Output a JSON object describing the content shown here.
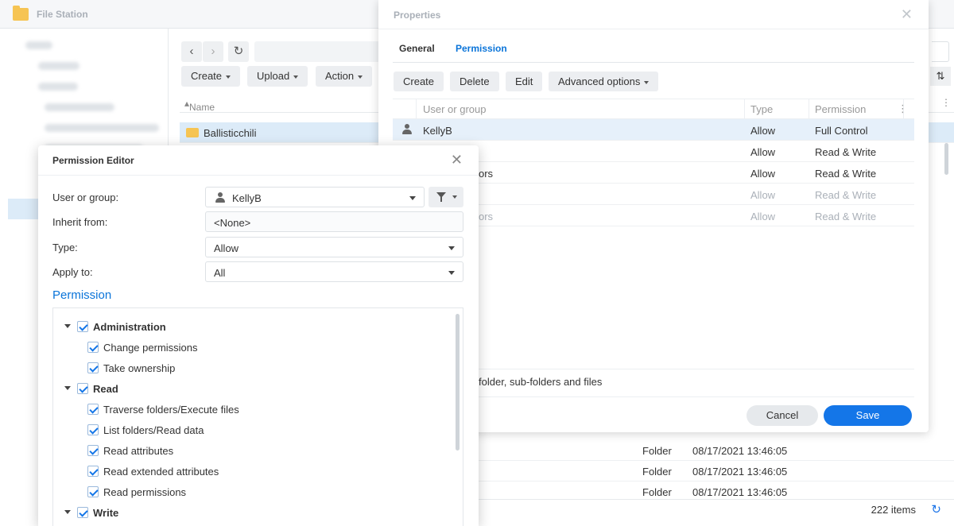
{
  "file_station": {
    "title": "File Station",
    "toolbar": {
      "create_label": "Create",
      "upload_label": "Upload",
      "action_label": "Action"
    },
    "column_name": "Name",
    "rows": [
      {
        "name": "Ballisticchili",
        "type": "",
        "date": ""
      },
      {
        "name": "",
        "type": "Folder",
        "date": "08/17/2021 13:46:05"
      },
      {
        "name": "",
        "type": "Folder",
        "date": "08/17/2021 13:46:05"
      },
      {
        "name": "",
        "type": "Folder",
        "date": "08/17/2021 13:46:05"
      }
    ],
    "item_count": "222 items"
  },
  "properties": {
    "title": "Properties",
    "tabs": [
      {
        "label": "General",
        "active": false
      },
      {
        "label": "Permission",
        "active": true
      }
    ],
    "buttons": {
      "create": "Create",
      "delete": "Delete",
      "edit": "Edit",
      "advanced": "Advanced options"
    },
    "columns": {
      "user": "User or group",
      "type": "Type",
      "permission": "Permission"
    },
    "entries": [
      {
        "name": "KellyB",
        "type": "Allow",
        "permission": "Full Control",
        "selected": true
      },
      {
        "name": "",
        "type": "Allow",
        "permission": "Read & Write"
      },
      {
        "name": "ors",
        "type": "Allow",
        "permission": "Read & Write"
      },
      {
        "name": "",
        "type": "Allow",
        "permission": "Read & Write",
        "dimmed": true
      },
      {
        "name": "ors",
        "type": "Allow",
        "permission": "Read & Write",
        "dimmed": true
      }
    ],
    "apply_text": "folder, sub-folders and files",
    "cancel_label": "Cancel",
    "save_label": "Save"
  },
  "permission_editor": {
    "title": "Permission Editor",
    "user_label": "User or group:",
    "user_value": "KellyB",
    "inherit_label": "Inherit from:",
    "inherit_value": "<None>",
    "type_label": "Type:",
    "type_value": "Allow",
    "apply_label": "Apply to:",
    "apply_value": "All",
    "permission_heading": "Permission",
    "tree": {
      "administration": "Administration",
      "change_permissions": "Change permissions",
      "take_ownership": "Take ownership",
      "read": "Read",
      "traverse": "Traverse folders/Execute files",
      "list_folders": "List folders/Read data",
      "read_attributes": "Read attributes",
      "read_extended": "Read extended attributes",
      "read_permissions": "Read permissions",
      "write": "Write"
    }
  },
  "colors": {
    "accent": "#1476e8",
    "selection": "#dcebf8",
    "folder": "#f6c453"
  }
}
